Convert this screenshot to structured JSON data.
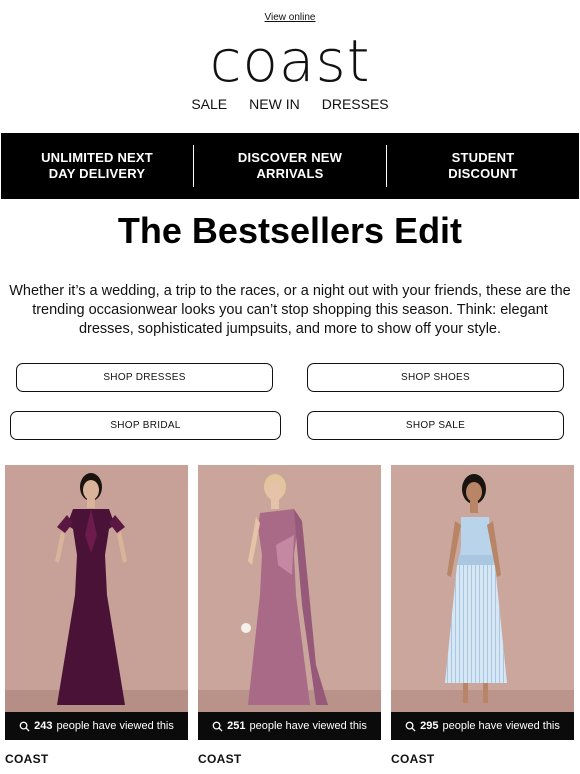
{
  "header": {
    "view_online": "View online",
    "logo": "coast",
    "nav": [
      "SALE",
      "NEW IN",
      "DRESSES"
    ]
  },
  "benefits": [
    {
      "line1": "UNLIMITED NEXT",
      "line2": "DAY DELIVERY"
    },
    {
      "line1": "DISCOVER NEW",
      "line2": "ARRIVALS"
    },
    {
      "line1": "STUDENT",
      "line2": "DISCOUNT"
    }
  ],
  "headline": "The Bestsellers Edit",
  "intro": "Whether it’s a wedding, a trip to the races, or a night out with your friends, these are the trending occasionwear looks you can’t stop shopping this season. Think: elegant dresses, sophisticated jumpsuits, and more to show off your style.",
  "buttons": [
    "SHOP DRESSES",
    "SHOP SHOES",
    "SHOP BRIDAL",
    "SHOP SALE"
  ],
  "products": [
    {
      "views": "243",
      "views_suffix": "people have viewed this",
      "brand": "COAST",
      "dress_color": "#4a1236",
      "accent": "#6d1a4e"
    },
    {
      "views": "251",
      "views_suffix": "people have viewed this",
      "brand": "COAST",
      "dress_color": "#a86a86",
      "accent": "#c488a2"
    },
    {
      "views": "295",
      "views_suffix": "people have viewed this",
      "brand": "COAST",
      "dress_color": "#b9d4ea",
      "accent": "#d5e6f4"
    }
  ],
  "colors": {
    "banner_bg": "#000000",
    "photo_bg": "#c9a59b",
    "overlay_bg": "#0b0b0b"
  }
}
